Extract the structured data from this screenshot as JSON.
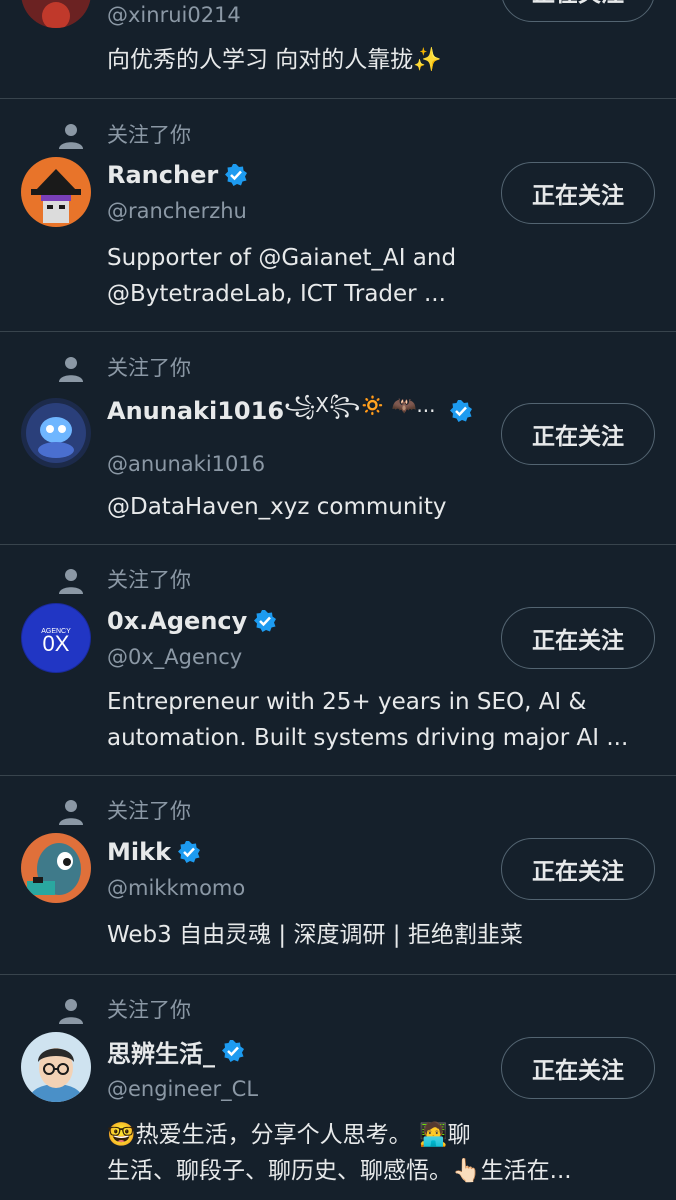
{
  "colors": {
    "background": "#15202b",
    "text_primary": "#e7e9ea",
    "text_secondary": "#8b98a5",
    "divider": "#38444d",
    "verified": "#1d9bf0",
    "button_border": "#536471"
  },
  "top_partial": {
    "handle": "@xinrui0214",
    "bio": "向优秀的人学习 向对的人靠拢✨",
    "button_label": "正在关注"
  },
  "context_icon": "person-icon",
  "verified_icon": "verified-badge-icon",
  "users": [
    {
      "context": "关注了你",
      "name": "Rancher",
      "handle": "@rancherzhu",
      "bio_lines": [
        "Supporter of @Gaianet_AI and",
        "@BytetradeLab, ICT Trader ..."
      ],
      "button_label": "正在关注",
      "avatar_icon": "pixel-wizard-avatar"
    },
    {
      "context": "关注了你",
      "name": "Anunaki1016",
      "name_suffix": "꧁X꧂🔅 🦇...",
      "handle": "@anunaki1016",
      "bio_lines": [
        "@DataHaven_xyz community"
      ],
      "button_label": "正在关注",
      "avatar_icon": "robot-dog-avatar"
    },
    {
      "context": "关注了你",
      "name": "0x.Agency",
      "handle": "@0x_Agency",
      "bio_lines": [
        "Entrepreneur with 25+ years in SEO, AI &",
        "automation. Built systems driving major AI ..."
      ],
      "button_label": "正在关注",
      "avatar_icon": "agency-logo-avatar",
      "avatar_text_top": "AGENCY",
      "avatar_text_main": "0X"
    },
    {
      "context": "关注了你",
      "name": "Mikk",
      "handle": "@mikkmomo",
      "bio_lines": [
        "Web3 自由灵魂 | 深度调研 | 拒绝割韭菜"
      ],
      "button_label": "正在关注",
      "avatar_icon": "cartoon-character-avatar"
    },
    {
      "context": "关注了你",
      "name": "思辨生活_",
      "handle": "@engineer_CL",
      "bio_lines": [
        "🤓热爱生活，分享个人思考。 🧑‍💻聊",
        "生活、聊段子、聊历史、聊感悟。👆🏻生活在..."
      ],
      "button_label": "正在关注",
      "avatar_icon": "glasses-man-avatar"
    }
  ]
}
